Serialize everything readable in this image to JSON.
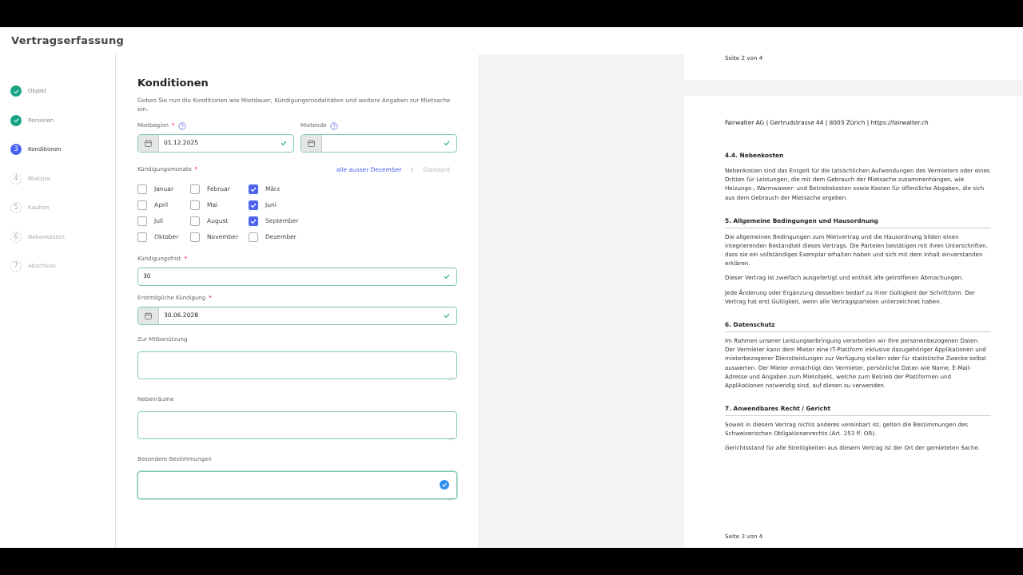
{
  "app": {
    "title": "Vertragserfassung"
  },
  "steps": [
    {
      "label": "Objekt",
      "completed": true,
      "selected": false
    },
    {
      "label": "Personen",
      "completed": true,
      "selected": false
    },
    {
      "number": "3",
      "label": "Konditionen",
      "completed": false,
      "selected": true
    },
    {
      "number": "4",
      "label": "Mietzins",
      "completed": false,
      "selected": false
    },
    {
      "number": "5",
      "label": "Kaution",
      "completed": false,
      "selected": false
    },
    {
      "number": "6",
      "label": "Nebenkosten",
      "completed": false,
      "selected": false
    },
    {
      "number": "7",
      "label": "Abschluss",
      "completed": false,
      "selected": false
    }
  ],
  "form": {
    "title": "Konditionen",
    "description": "Geben Sie nun die Konditionen wie Mietdauer, Kündigungsmodalitäten und weitere Angaben zur Mietsache ein.",
    "date_fields": [
      {
        "label": "Mietbeginn",
        "required_marker": "*",
        "help": true,
        "value": "01.12.2025",
        "valid": true
      },
      {
        "label": "Mietende",
        "help": true,
        "valid": true
      }
    ],
    "months": {
      "label": "Kündigungsmonate",
      "required_marker": "*",
      "separator": "/",
      "presets": [
        {
          "label": "alle ausser Dezember",
          "disabled": false
        },
        {
          "label": "Standard",
          "disabled": true
        }
      ],
      "options": [
        {
          "label": "Januar",
          "checked": false
        },
        {
          "label": "Februar",
          "checked": false
        },
        {
          "label": "März",
          "checked": true
        },
        {
          "label": "April",
          "checked": false
        },
        {
          "label": "Mai",
          "checked": false
        },
        {
          "label": "Juni",
          "checked": true
        },
        {
          "label": "Juli",
          "checked": false
        },
        {
          "label": "August",
          "checked": false
        },
        {
          "label": "September",
          "checked": true
        },
        {
          "label": "Oktober",
          "checked": false
        },
        {
          "label": "November",
          "checked": false
        },
        {
          "label": "Dezember",
          "checked": false
        }
      ]
    },
    "fields": [
      {
        "kind": "text",
        "label": "Kündigungsfrist",
        "required_marker": "*",
        "value": "30",
        "valid": true
      },
      {
        "kind": "date",
        "label": "Erstmögliche Kündigung",
        "required_marker": "*",
        "value": "30.06.2028",
        "valid": true
      },
      {
        "kind": "textarea",
        "label": "Zur Mitbenützung",
        "focused": false
      },
      {
        "kind": "textarea",
        "label": "Nebenräume",
        "focused": false
      },
      {
        "kind": "textarea",
        "label": "Besondere Bestimmungen",
        "focused": true
      }
    ]
  },
  "document": {
    "pages": [
      {
        "footer": "Seite 2 von 4"
      },
      {
        "header": "Fairwalter AG | Gertrudstrasse 44 | 8003 Zürich | https://fairwalter.ch",
        "sections": [
          {
            "heading": "4.4. Nebenkosten",
            "underlined": false,
            "paragraphs": [
              "Nebenkosten sind das Entgelt für die tatsächlichen Aufwendungen des Vermieters oder eines Dritten für Leistungen, die mit dem Gebrauch der Mietsache zusammenhängen, wie Heizungs-, Warmwasser- und Betriebskosten sowie Kosten für öffentliche Abgaben, die sich aus dem Gebrauch der Mietsache ergeben."
            ]
          },
          {
            "heading": "5. Allgemeine Bedingungen und Hausordnung",
            "underlined": true,
            "paragraphs": [
              "Die allgemeinen Bedingungen zum Mietvertrag und die Hausordnung bilden einen integrierenden Bestandteil dieses Vertrags. Die Parteien bestätigen mit ihren Unterschriften, dass sie ein vollständiges Exemplar erhalten haben und sich mit dem Inhalt einverstanden erklären.",
              "Dieser Vertrag ist zweifach ausgefertigt und enthält alle getroffenen Abmachungen.",
              "Jede Änderung oder Ergänzung desselben bedarf zu ihrer Gültigkeit der Schriftform. Der Vertrag hat erst Gültigkeit, wenn alle Vertragsparteien unterzeichnet haben."
            ]
          },
          {
            "heading": "6. Datenschutz",
            "underlined": true,
            "paragraphs": [
              "Im Rahmen unserer Leistungserbringung verarbeiten wir Ihre personenbezogenen Daten. Der Vermieter kann dem Mieter eine IT-Plattform inklusive dazugehöriger Applikationen und mieterbezogener Dienstleistungen zur Verfügung stellen oder für statistische Zwecke selbst auswerten. Der Mieter ermächtigt den Vermieter, persönliche Daten wie Name, E-Mail-Adresse und Angaben zum Mietobjekt, welche zum Betrieb der Plattformen und Applikationen notwendig sind, auf diesen zu verwenden."
            ]
          },
          {
            "heading": "7. Anwendbares Recht / Gericht",
            "underlined": true,
            "paragraphs": [
              "Soweit in diesem Vertrag nichts anderes vereinbart ist, gelten die Bestimmungen des Schweizerischen Obligationenrechts (Art. 253 ff. OR).",
              "Gerichtsstand für alle Streitigkeiten aus diesem Vertrag ist der Ort der gemieteten Sache."
            ]
          }
        ],
        "footer": "Seite 3 von 4"
      }
    ]
  }
}
